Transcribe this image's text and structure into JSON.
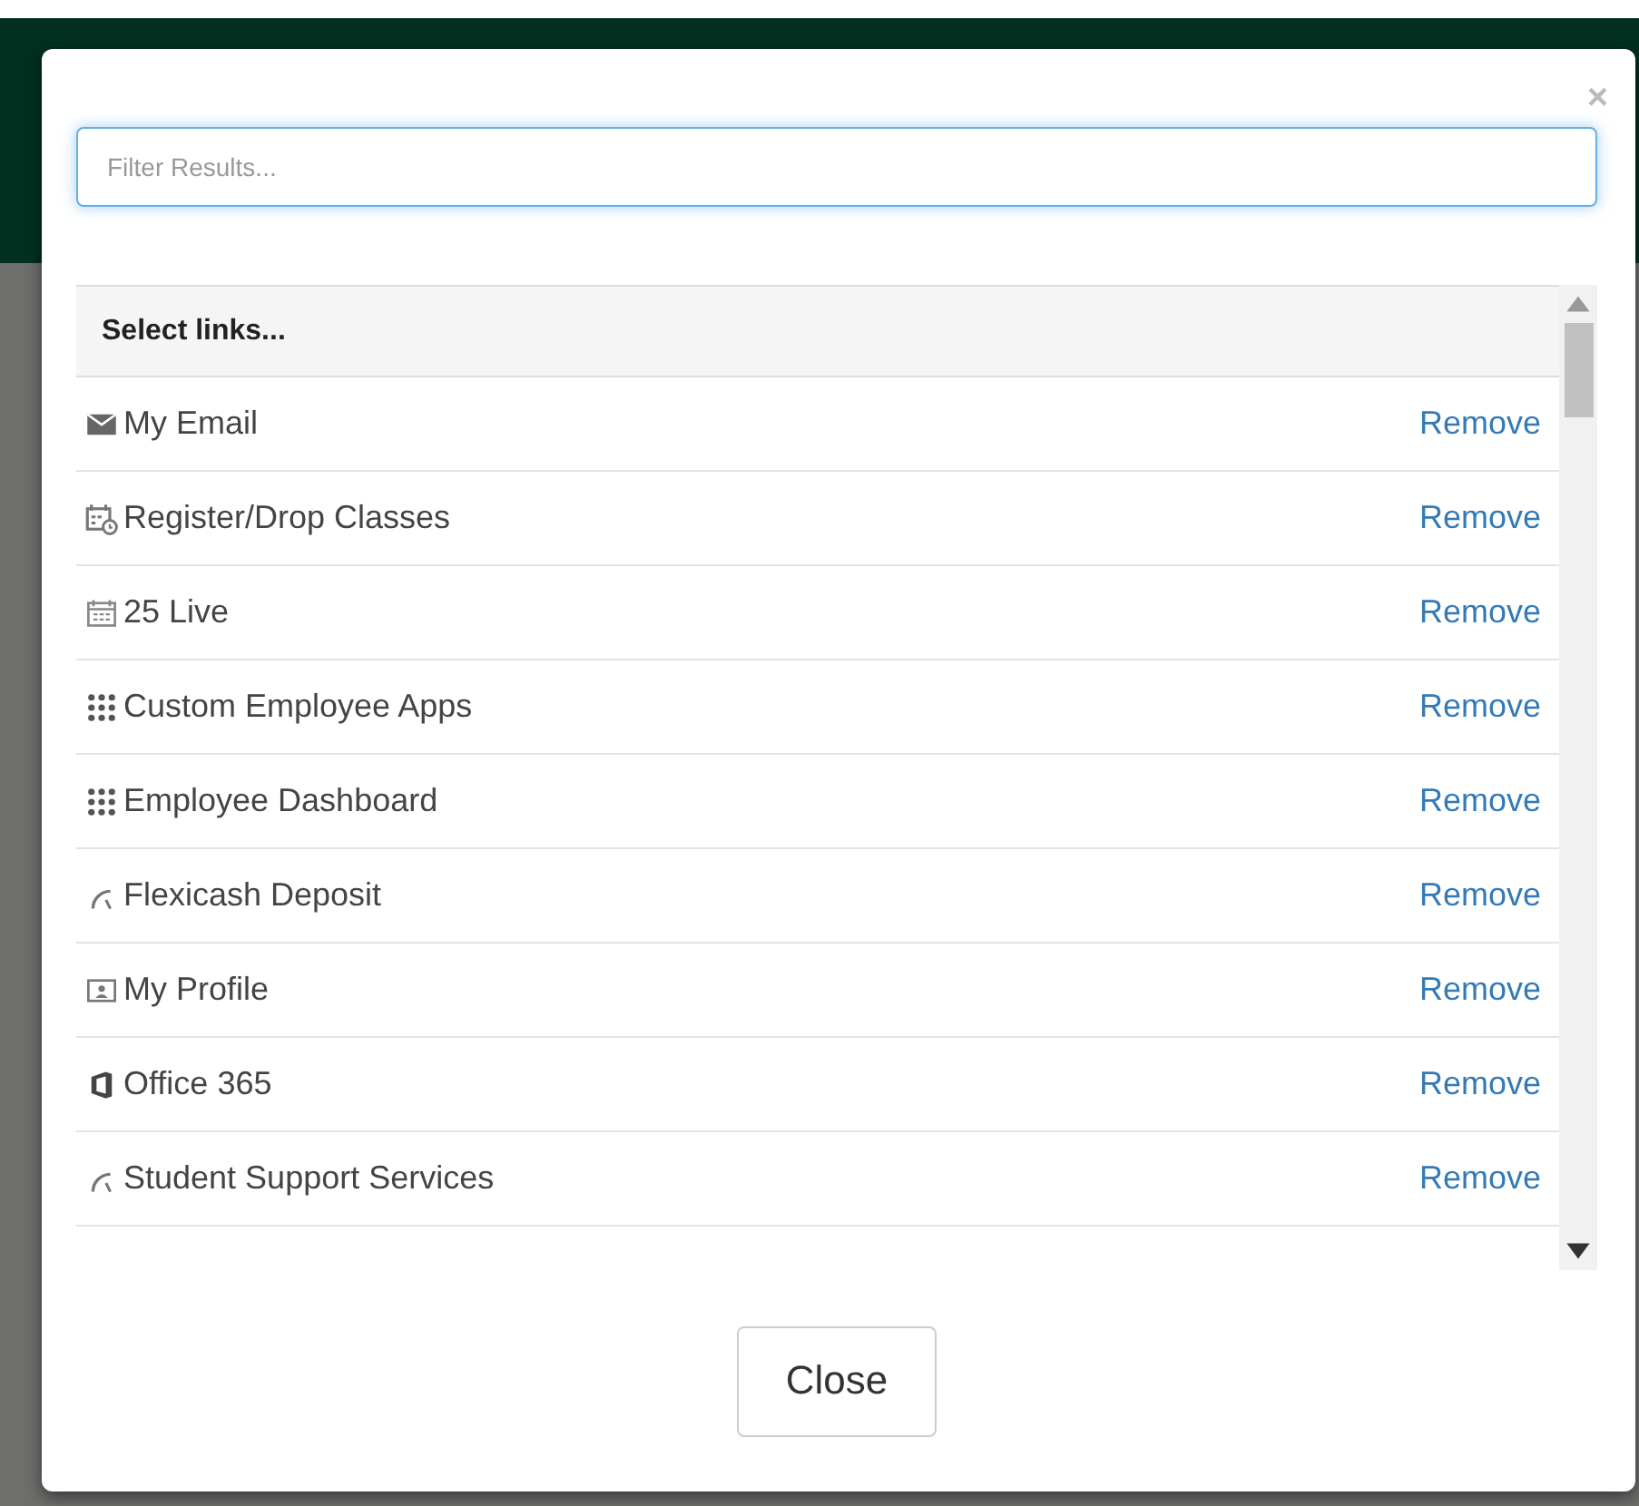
{
  "filter": {
    "placeholder": "Filter Results..."
  },
  "list": {
    "header": "Select links...",
    "items": [
      {
        "label": "My Email",
        "kind": "email",
        "action": "Remove"
      },
      {
        "label": "Register/Drop Classes",
        "kind": "schedule",
        "action": "Remove"
      },
      {
        "label": "25 Live",
        "kind": "calendar",
        "action": "Remove"
      },
      {
        "label": "Custom Employee Apps",
        "kind": "grid",
        "action": "Remove"
      },
      {
        "label": "Employee Dashboard",
        "kind": "grid",
        "action": "Remove"
      },
      {
        "label": "Flexicash Deposit",
        "kind": "gauge",
        "action": "Remove"
      },
      {
        "label": "My Profile",
        "kind": "profile",
        "action": "Remove"
      },
      {
        "label": "Office 365",
        "kind": "office",
        "action": "Remove"
      },
      {
        "label": "Student Support Services",
        "kind": "gauge",
        "action": "Remove"
      }
    ]
  },
  "close_icon": "×",
  "buttons": [
    "Close"
  ]
}
